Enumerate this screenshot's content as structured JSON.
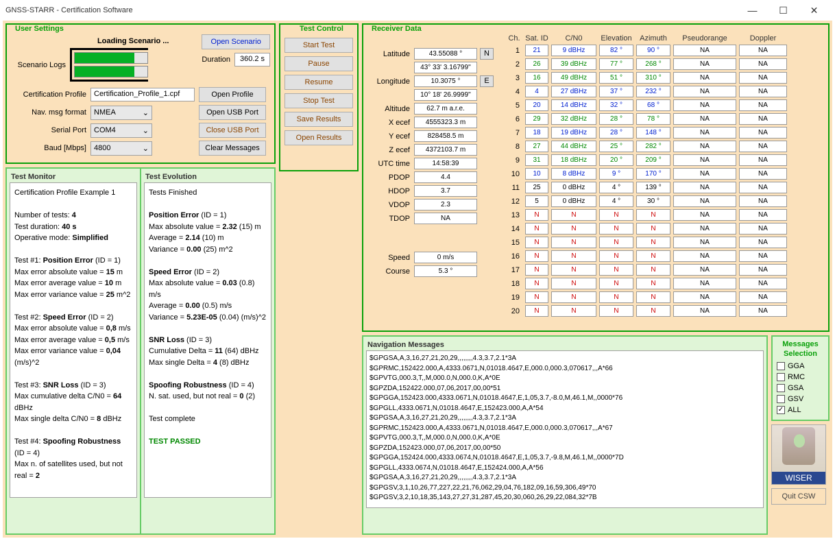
{
  "titlebar": {
    "title": "GNSS-STARR - Certification Software"
  },
  "user_settings": {
    "title": "User Settings",
    "loading": "Loading Scenario ...",
    "scenario_logs": "Scenario Logs",
    "open_scenario": "Open Scenario",
    "duration_lbl": "Duration",
    "duration_val": "360.2 s",
    "cert_profile_lbl": "Certification Profile",
    "cert_profile_val": "Certification_Profile_1.cpf",
    "open_profile": "Open Profile",
    "nav_fmt_lbl": "Nav. msg format",
    "nav_fmt_val": "NMEA",
    "open_usb": "Open USB Port",
    "serial_lbl": "Serial Port",
    "serial_val": "COM4",
    "close_usb": "Close USB Port",
    "baud_lbl": "Baud [Mbps]",
    "baud_val": "4800",
    "clear_msg": "Clear Messages"
  },
  "test_control": {
    "title": "Test Control",
    "start": "Start Test",
    "pause": "Pause",
    "resume": "Resume",
    "stop": "Stop Test",
    "save": "Save Results",
    "open": "Open Results"
  },
  "test_monitor": {
    "title": "Test Monitor",
    "body": "Certification Profile Example 1\n\nNumber of tests:  <b>4</b>\nTest duration:       <b>40 s</b>\nOperative mode:  <b>Simplified</b>\n\nTest #1: <b>Position Error</b> (ID = 1)\nMax error absolute value = <b>15</b> m\nMax error average value = <b>10</b> m\nMax error variance value = <b>25</b> m^2\n\nTest #2: <b>Speed Error</b>  (ID = 2)\nMax error absolute value = <b>0,8</b> m/s\nMax error average value = <b>0,5</b> m/s\nMax error variance value = <b>0,04</b> (m/s)^2\n\nTest #3: <b>SNR Loss</b>  (ID = 3)\nMax cumulative delta C/N0 = <b>64</b> dBHz\nMax single delta C/N0 = <b>8</b> dBHz\n\nTest #4: <b>Spoofing Robustness</b>  (ID = 4)\nMax n. of satellites used, but not real = <b>2</b>"
  },
  "test_evolution": {
    "title": "Test Evolution",
    "body": "Tests Finished\n\n<b>Position Error</b> (ID = 1)\nMax absolute value = <b>2.32</b> (15) m\nAverage = <b>2.14</b> (10) m\nVariance = <b>0.00</b> (25) m^2\n\n<b>Speed Error</b> (ID = 2)\nMax absolute value = <b>0.03</b> (0.8) m/s\nAverage = <b>0.00</b> (0.5) m/s\nVariance = <b>5.23E-05</b> (0.04) (m/s)^2\n\n<b>SNR Loss</b> (ID = 3)\nCumulative Delta = <b>11</b> (64) dBHz\nMax single Delta = <b>4</b> (8) dBHz\n\n<b>Spoofing Robustness</b> (ID = 4)\nN. sat. used, but not real = <b>0</b> (2)\n\nTest complete\n\n<b style='color:#008800'>TEST PASSED</b>"
  },
  "receiver": {
    "title": "Receiver Data",
    "labels": {
      "lat": "Latitude",
      "lon": "Longitude",
      "alt": "Altitude",
      "xecef": "X ecef",
      "yecef": "Y ecef",
      "zecef": "Z ecef",
      "utc": "UTC time",
      "pdop": "PDOP",
      "hdop": "HDOP",
      "vdop": "VDOP",
      "tdop": "TDOP",
      "speed": "Speed",
      "course": "Course"
    },
    "vals": {
      "lat1": "43.55088 °",
      "lat2": "43° 33' 3.16799''",
      "lat_hem": "N",
      "lon1": "10.3075 °",
      "lon2": "10° 18' 26.9999''",
      "lon_hem": "E",
      "alt": "62.7 m a.r.e.",
      "xecef": "4555323.3 m",
      "yecef": "828458.5 m",
      "zecef": "4372103.7 m",
      "utc": "14:58:39",
      "pdop": "4.4",
      "hdop": "3.7",
      "vdop": "2.3",
      "tdop": "NA",
      "speed": "0 m/s",
      "course": "5.3 °"
    }
  },
  "sat_hdr": {
    "ch": "Ch.",
    "id": "Sat. ID",
    "cn": "C/N0",
    "el": "Elevation",
    "az": "Azimuth",
    "pr": "Pseudorange",
    "dp": "Doppler"
  },
  "sats": [
    {
      "ch": "1",
      "id": "21",
      "cn": "9 dBHz",
      "el": "82 °",
      "az": "90 °",
      "pr": "NA",
      "dp": "NA",
      "cls": "blue"
    },
    {
      "ch": "2",
      "id": "26",
      "cn": "39 dBHz",
      "el": "77 °",
      "az": "268 °",
      "pr": "NA",
      "dp": "NA",
      "cls": "grn"
    },
    {
      "ch": "3",
      "id": "16",
      "cn": "49 dBHz",
      "el": "51 °",
      "az": "310 °",
      "pr": "NA",
      "dp": "NA",
      "cls": "grn"
    },
    {
      "ch": "4",
      "id": "4",
      "cn": "27 dBHz",
      "el": "37 °",
      "az": "232 °",
      "pr": "NA",
      "dp": "NA",
      "cls": "blue"
    },
    {
      "ch": "5",
      "id": "20",
      "cn": "14 dBHz",
      "el": "32 °",
      "az": "68 °",
      "pr": "NA",
      "dp": "NA",
      "cls": "blue"
    },
    {
      "ch": "6",
      "id": "29",
      "cn": "32 dBHz",
      "el": "28 °",
      "az": "78 °",
      "pr": "NA",
      "dp": "NA",
      "cls": "grn"
    },
    {
      "ch": "7",
      "id": "18",
      "cn": "19 dBHz",
      "el": "28 °",
      "az": "148 °",
      "pr": "NA",
      "dp": "NA",
      "cls": "blue"
    },
    {
      "ch": "8",
      "id": "27",
      "cn": "44 dBHz",
      "el": "25 °",
      "az": "282 °",
      "pr": "NA",
      "dp": "NA",
      "cls": "grn"
    },
    {
      "ch": "9",
      "id": "31",
      "cn": "18 dBHz",
      "el": "20 °",
      "az": "209 °",
      "pr": "NA",
      "dp": "NA",
      "cls": "grn"
    },
    {
      "ch": "10",
      "id": "10",
      "cn": "8 dBHz",
      "el": "9 °",
      "az": "170 °",
      "pr": "NA",
      "dp": "NA",
      "cls": "blue"
    },
    {
      "ch": "11",
      "id": "25",
      "cn": "0 dBHz",
      "el": "4 °",
      "az": "139 °",
      "pr": "NA",
      "dp": "NA",
      "cls": ""
    },
    {
      "ch": "12",
      "id": "5",
      "cn": "0 dBHz",
      "el": "4 °",
      "az": "30 °",
      "pr": "NA",
      "dp": "NA",
      "cls": ""
    },
    {
      "ch": "13",
      "id": "N",
      "cn": "N",
      "el": "N",
      "az": "N",
      "pr": "NA",
      "dp": "NA",
      "cls": "red"
    },
    {
      "ch": "14",
      "id": "N",
      "cn": "N",
      "el": "N",
      "az": "N",
      "pr": "NA",
      "dp": "NA",
      "cls": "red"
    },
    {
      "ch": "15",
      "id": "N",
      "cn": "N",
      "el": "N",
      "az": "N",
      "pr": "NA",
      "dp": "NA",
      "cls": "red"
    },
    {
      "ch": "16",
      "id": "N",
      "cn": "N",
      "el": "N",
      "az": "N",
      "pr": "NA",
      "dp": "NA",
      "cls": "red"
    },
    {
      "ch": "17",
      "id": "N",
      "cn": "N",
      "el": "N",
      "az": "N",
      "pr": "NA",
      "dp": "NA",
      "cls": "red"
    },
    {
      "ch": "18",
      "id": "N",
      "cn": "N",
      "el": "N",
      "az": "N",
      "pr": "NA",
      "dp": "NA",
      "cls": "red"
    },
    {
      "ch": "19",
      "id": "N",
      "cn": "N",
      "el": "N",
      "az": "N",
      "pr": "NA",
      "dp": "NA",
      "cls": "red"
    },
    {
      "ch": "20",
      "id": "N",
      "cn": "N",
      "el": "N",
      "az": "N",
      "pr": "NA",
      "dp": "NA",
      "cls": "red"
    }
  ],
  "nav_messages": {
    "title": "Navigation Messages",
    "body": "$GPGSA,A,3,16,27,21,20,29,,,,,,,,4.3,3.7,2.1*3A\n$GPRMC,152422.000,A,4333.0671,N,01018.4647,E,000.0,000.3,070617,,,A*66\n$GPVTG,000.3,T,,M,000.0,N,000.0,K,A*0E\n$GPZDA,152422.000,07,06,2017,00,00*51\n$GPGGA,152423.000,4333.0671,N,01018.4647,E,1,05,3.7,-8.0,M,46.1,M,,0000*76\n$GPGLL,4333.0671,N,01018.4647,E,152423.000,A,A*54\n$GPGSA,A,3,16,27,21,20,29,,,,,,,,4.3,3.7,2.1*3A\n$GPRMC,152423.000,A,4333.0671,N,01018.4647,E,000.0,000.3,070617,,,A*67\n$GPVTG,000.3,T,,M,000.0,N,000.0,K,A*0E\n$GPZDA,152423.000,07,06,2017,00,00*50\n$GPGGA,152424.000,4333.0674,N,01018.4647,E,1,05,3.7,-9.8,M,46.1,M,,0000*7D\n$GPGLL,4333.0674,N,01018.4647,E,152424.000,A,A*56\n$GPGSA,A,3,16,27,21,20,29,,,,,,,,4.3,3.7,2.1*3A\n$GPGSV,3,1,10,26,77,227,22,21,76,062,29,04,76,182,09,16,59,306,49*70\n$GPGSV,3,2,10,18,35,143,27,27,31,287,45,20,30,060,26,29,22,084,32*7B"
  },
  "msg_sel": {
    "title1": "Messages",
    "title2": "Selection",
    "gga": "GGA",
    "rmc": "RMC",
    "gsa": "GSA",
    "gsv": "GSV",
    "all": "ALL"
  },
  "wiser": "WISER",
  "quit": "Quit CSW"
}
